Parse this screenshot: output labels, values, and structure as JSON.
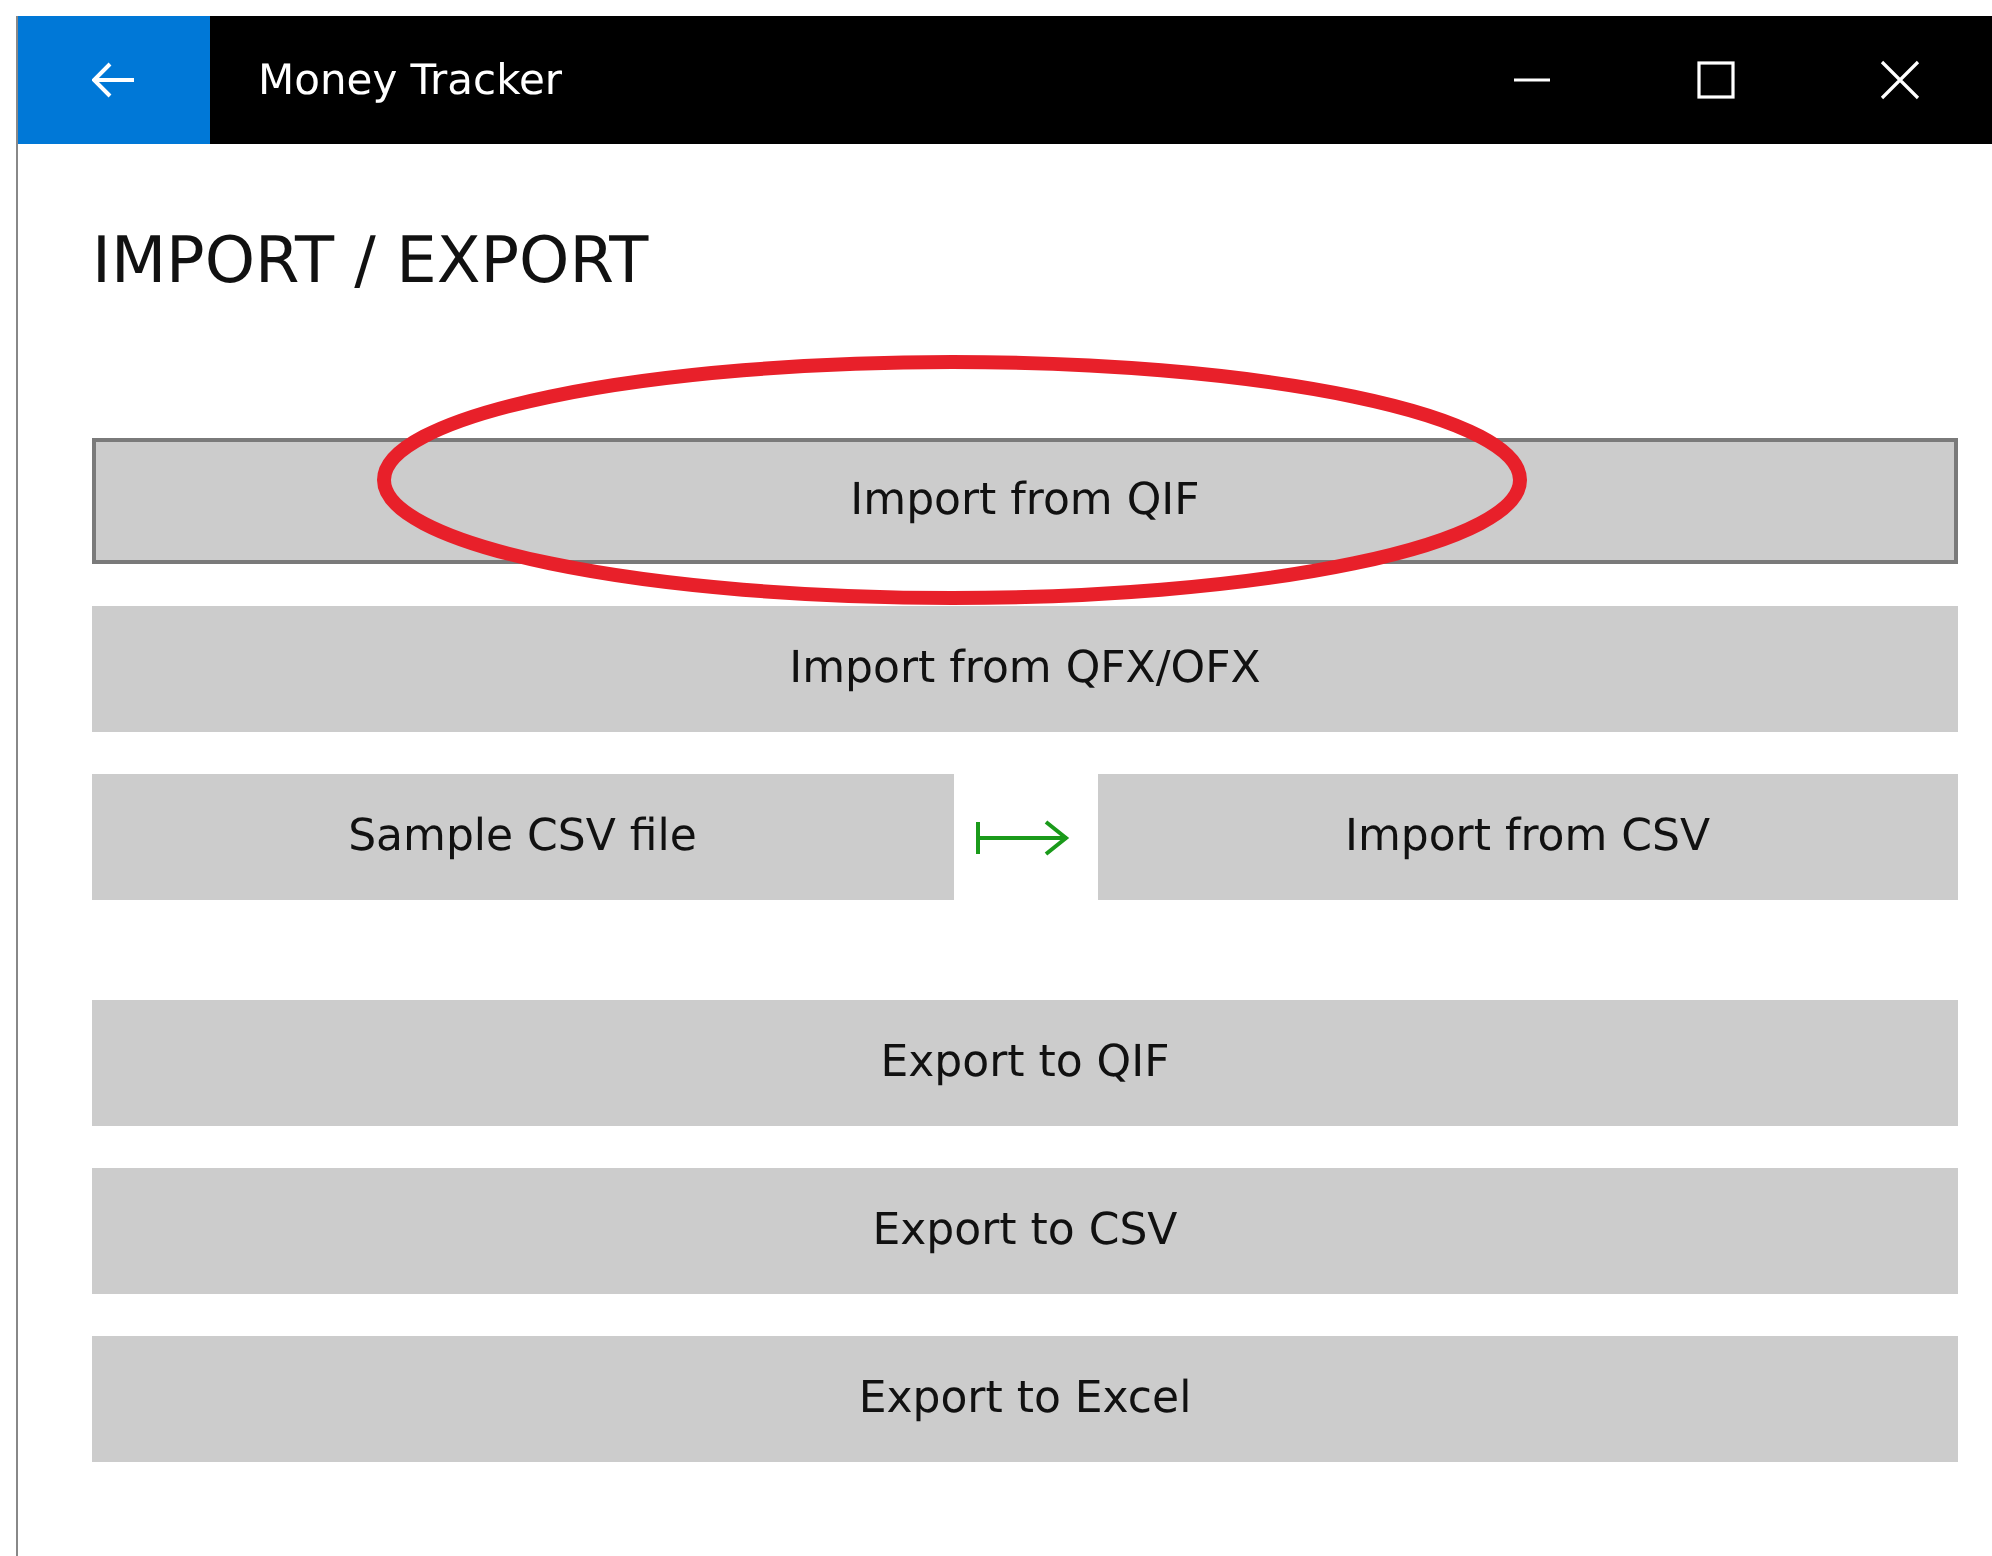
{
  "window": {
    "title": "Money Tracker"
  },
  "page_title": "IMPORT / EXPORT",
  "import_buttons": [
    {
      "label": "Import from QIF",
      "focused": true
    },
    {
      "label": "Import from QFX/OFX",
      "focused": false
    }
  ],
  "csv_row": {
    "sample_label": "Sample CSV file",
    "import_label": "Import from CSV"
  },
  "export_buttons": [
    {
      "label": "Export to QIF",
      "focused": false
    },
    {
      "label": "Export to CSV",
      "focused": false
    },
    {
      "label": "Export to Excel",
      "focused": false
    }
  ]
}
